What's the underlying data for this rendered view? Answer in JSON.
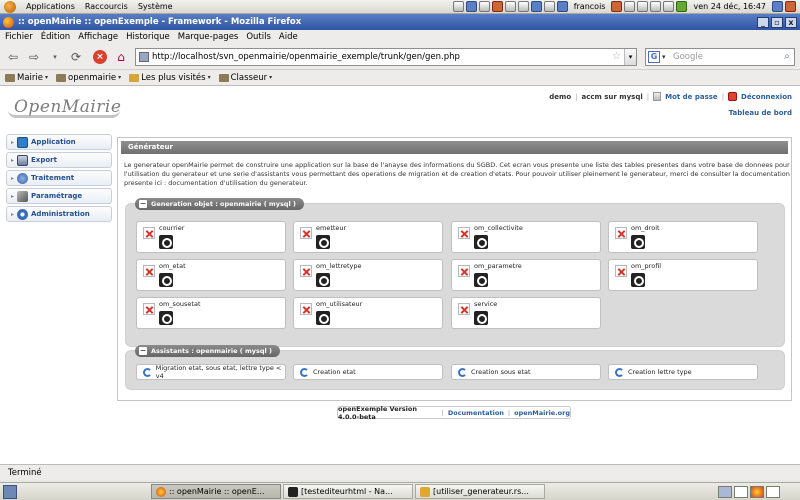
{
  "gnome_top": {
    "menus": [
      "Applications",
      "Raccourcis",
      "Système"
    ],
    "user": "francois",
    "clock": "ven 24 déc, 16:47"
  },
  "window": {
    "title": ":: openMairie :: openExemple - Framework - Mozilla Firefox",
    "controls": [
      "_",
      "▫",
      "x"
    ]
  },
  "firefox": {
    "menu": [
      "Fichier",
      "Édition",
      "Affichage",
      "Historique",
      "Marque-pages",
      "Outils",
      "Aide"
    ],
    "url": "http://localhost/svn_openmairie/openmairie_exemple/trunk/gen/gen.php",
    "search_placeholder": "Google",
    "search_engine": "G",
    "bookmarks": [
      "Mairie",
      "openmairie",
      "Les plus visités",
      "Classeur"
    ],
    "status": "Terminé"
  },
  "page": {
    "logo_text": "OpenMairie",
    "topnav": {
      "user": "demo",
      "db": "accm sur mysql",
      "password": "Mot de passe",
      "logout": "Déconnexion",
      "dashboard": "Tableau de bord"
    },
    "sidebar": [
      {
        "label": "Application",
        "icon": "application-icon"
      },
      {
        "label": "Export",
        "icon": "export-icon"
      },
      {
        "label": "Traitement",
        "icon": "traitement-icon"
      },
      {
        "label": "Paramétrage",
        "icon": "tools-icon"
      },
      {
        "label": "Administration",
        "icon": "admin-icon"
      }
    ],
    "panel_title": "Générateur",
    "intro": "Le generateur openMairie permet de construire une application sur la base de l'anayse des informations du SGBD. Cet ecran vous presente une liste des tables presentes dans votre base de donnees pour l'utilisation du generateur et une serie d'assistants vous permettant des operations de migration et de creation d'etats. Pour pouvoir utiliser pleinement le generateur, merci de consulter la documentation presente ici : documentation d'utilisation du generateur.",
    "generation": {
      "legend": "Generation objet : openmairie ( mysql )",
      "objects": [
        "courrier",
        "emetteur",
        "om_collectivite",
        "om_droit",
        "om_etat",
        "om_lettretype",
        "om_parametre",
        "om_profil",
        "om_sousetat",
        "om_utilisateur",
        "service"
      ]
    },
    "assistants": {
      "legend": "Assistants : openmairie ( mysql )",
      "items": [
        "Migration etat, sous etat, lettre type < v4",
        "Creation etat",
        "Creation sous etat",
        "Creation lettre type"
      ]
    },
    "footer": {
      "version": "openExemple Version 4.0.0-beta",
      "doc": "Documentation",
      "site": "openMairie.org"
    }
  },
  "taskbar": {
    "tasks": [
      ":: openMairie :: openE...",
      "[testediteurhtml - Na...",
      "[utiliser_generateur.rs..."
    ]
  }
}
